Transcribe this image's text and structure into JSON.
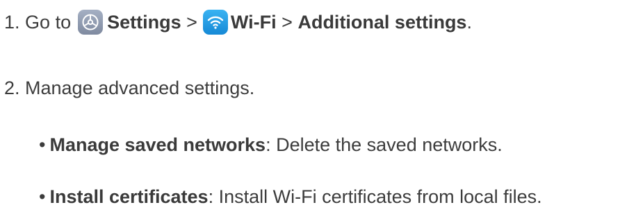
{
  "step1": {
    "number": "1.",
    "go_to": "Go to",
    "settings": "Settings",
    "sep1": ">",
    "wifi": "Wi-Fi",
    "sep2": ">",
    "additional": "Additional settings",
    "period": ".",
    "settings_icon": "settings-gear-icon",
    "wifi_icon": "wifi-icon"
  },
  "step2": {
    "text": "2. Manage advanced settings."
  },
  "bullets": [
    {
      "symbol": "•",
      "title": "Manage saved networks",
      "desc": ": Delete the saved networks."
    },
    {
      "symbol": "•",
      "title": "Install certificates",
      "desc": ": Install Wi-Fi certificates from local files."
    }
  ],
  "colors": {
    "text": "#3c3c3c",
    "settings_icon_bg": "#8f9ab0",
    "wifi_icon_bg": "#1f9ae0"
  }
}
